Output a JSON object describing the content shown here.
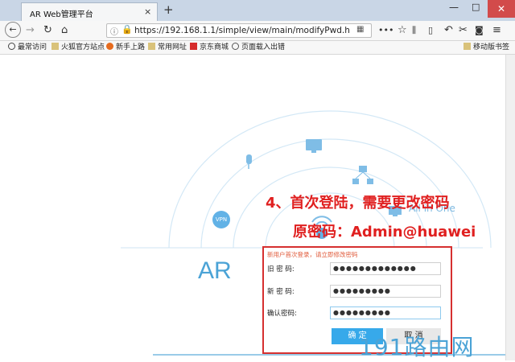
{
  "browser": {
    "tab_title": "AR Web管理平台",
    "tab_close": "×",
    "new_tab": "+",
    "url": "https://192.168.1.1/simple/view/main/modifyPwd.h"
  },
  "window_controls": {
    "minimize": "—",
    "maximize": "□",
    "close": "✕"
  },
  "bookmarks": [
    {
      "label": "最常访问",
      "icon": "gear-icon"
    },
    {
      "label": "火狐官方站点",
      "icon": "folder-icon"
    },
    {
      "label": "新手上路",
      "icon": "firefox-icon"
    },
    {
      "label": "常用网址",
      "icon": "folder-icon"
    },
    {
      "label": "京东商城",
      "icon": "jd-icon"
    },
    {
      "label": "页面载入出错",
      "icon": "globe-icon"
    }
  ],
  "mobile_bookmarks": "移动版书签",
  "page": {
    "ar_label": "AR",
    "all_in_one": "All in One",
    "vpn": "VPN",
    "annotation_step": "4、首次登陆，需要更改密码",
    "annotation_password": "原密码：Admin@huawei"
  },
  "form": {
    "hint": "新用户首次登录，请立即修改密码",
    "old_label": "旧 密 码:",
    "old_value": "●●●●●●●●●●●●●",
    "new_label": "新 密 码:",
    "new_value": "●●●●●●●●●",
    "confirm_label": "确认密码:",
    "confirm_value": "●●●●●●●●●",
    "ok_label": "确 定",
    "cancel_label": "取 消"
  },
  "watermark": "191路由网",
  "colors": {
    "accent": "#37a9ea",
    "annotation": "#e02020",
    "border": "#d63030"
  }
}
